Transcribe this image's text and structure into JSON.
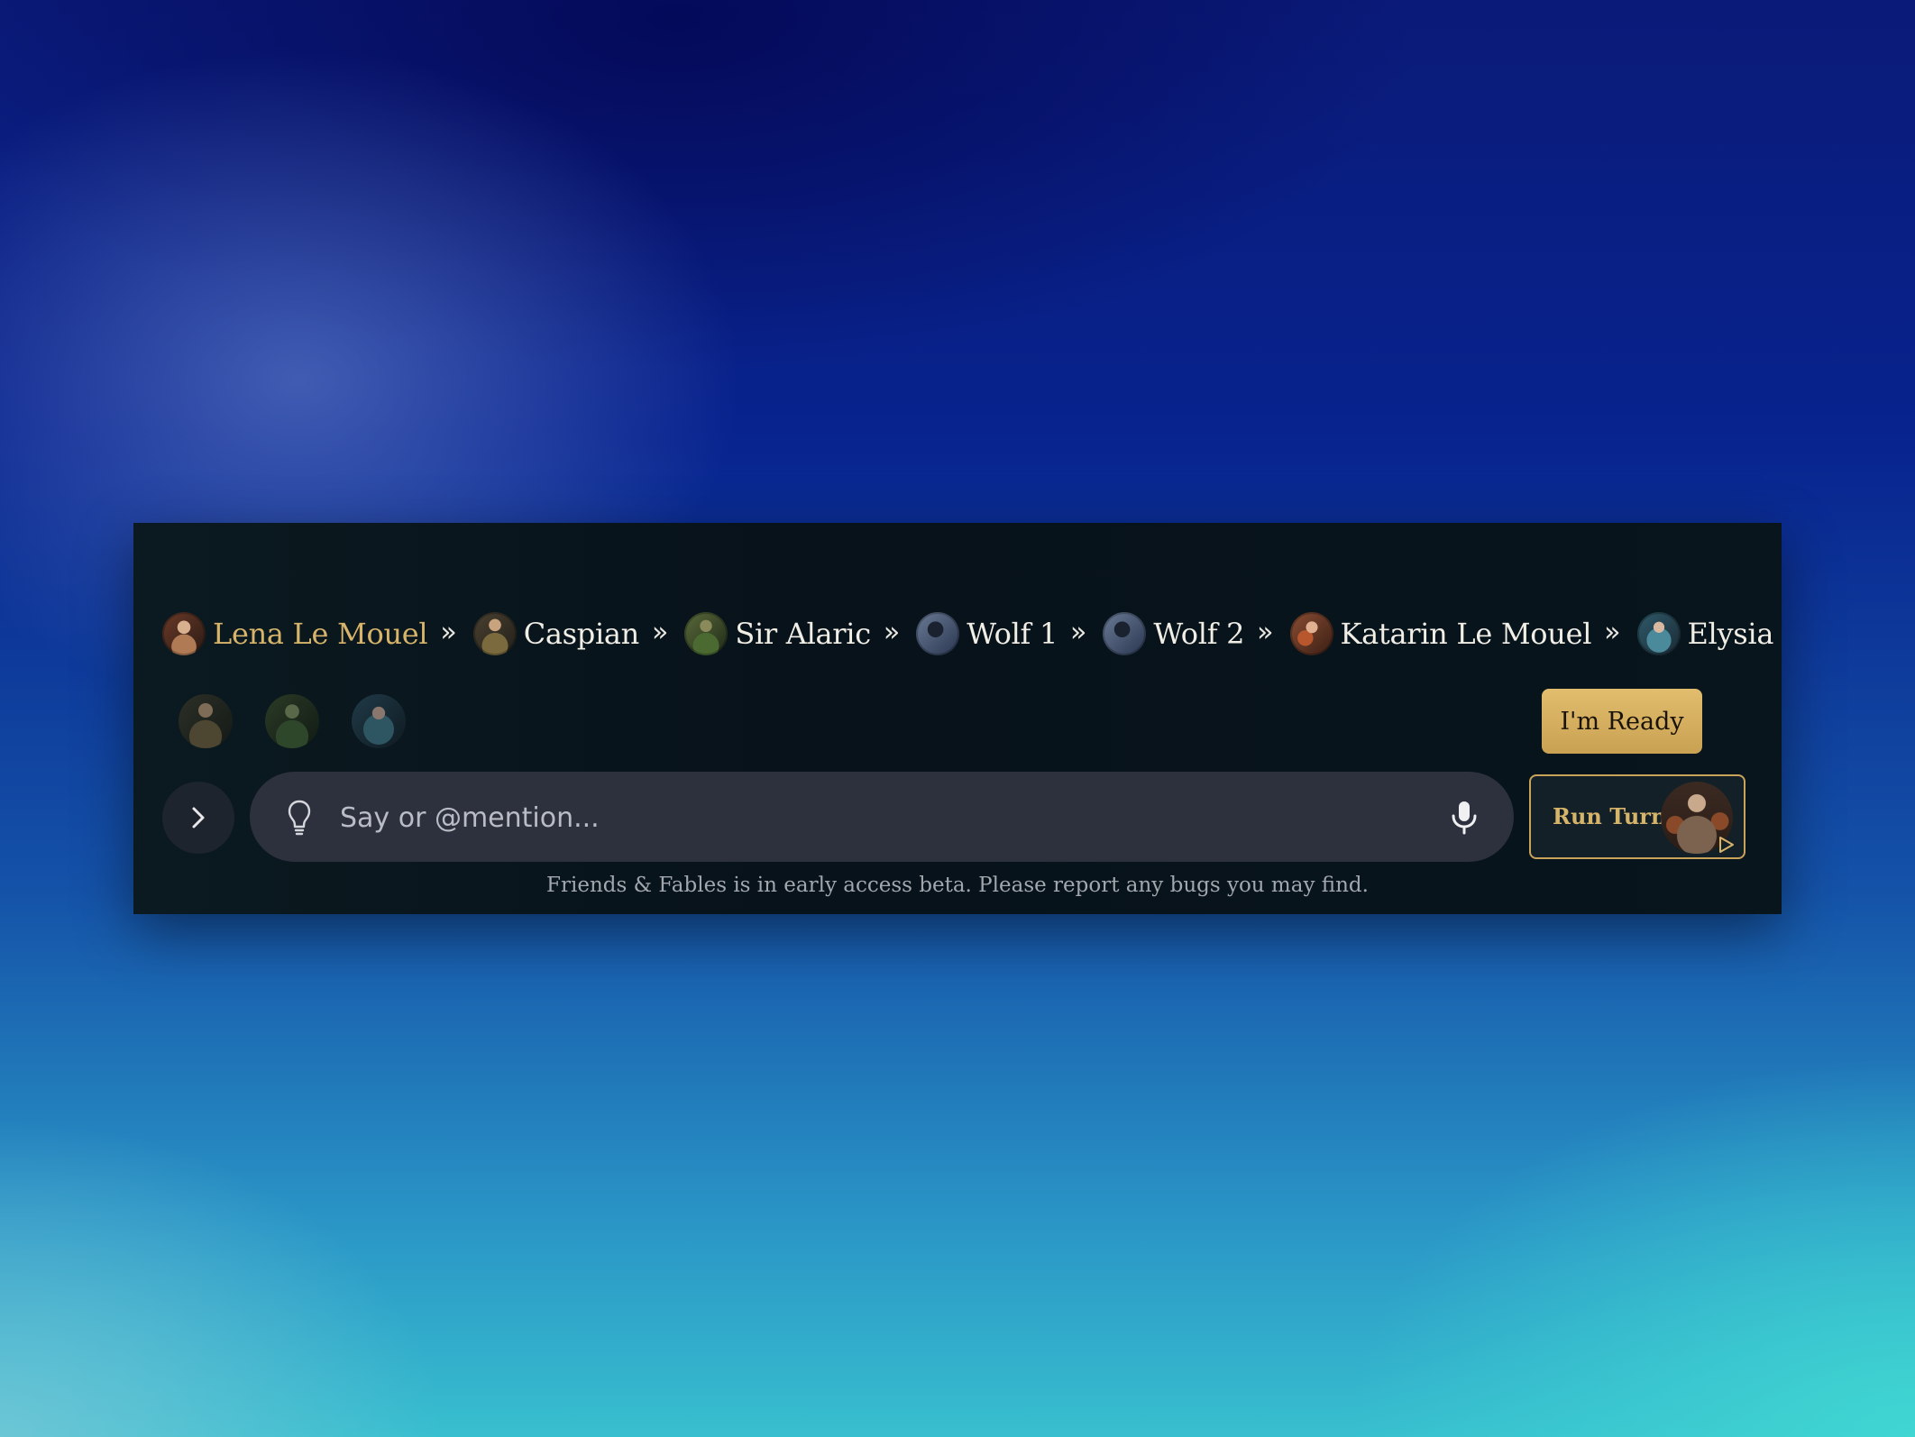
{
  "turn_order": {
    "items": [
      {
        "name": "Lena Le Mouel",
        "active": true,
        "avatar_color": "#8b5a43"
      },
      {
        "name": "Caspian",
        "active": false,
        "avatar_color": "#6b5a3a"
      },
      {
        "name": "Sir Alaric",
        "active": false,
        "avatar_color": "#5b6b3a"
      },
      {
        "name": "Wolf 1",
        "active": false,
        "avatar_color": "#3a4a66"
      },
      {
        "name": "Wolf 2",
        "active": false,
        "avatar_color": "#3a4a66"
      },
      {
        "name": "Katarin Le Mouel",
        "active": false,
        "avatar_color": "#8a4d33"
      },
      {
        "name": "Elysia",
        "active": false,
        "avatar_color": "#3f6b7a"
      }
    ],
    "separator": "»"
  },
  "ready_avatars": [
    {
      "avatar_color": "#4a4a3a"
    },
    {
      "avatar_color": "#3e5a34"
    },
    {
      "avatar_color": "#3d6070"
    }
  ],
  "ready_button": {
    "label": "I'm Ready"
  },
  "composer": {
    "placeholder": "Say or @mention...",
    "value": ""
  },
  "run_turn": {
    "label": "Run Turn"
  },
  "footer": {
    "beta_note": "Friends & Fables is in early access beta. Please report any bugs you may find."
  },
  "colors": {
    "accent_gold": "#d8b46b",
    "panel_bg": "#0a151c",
    "input_bg": "#2d313d"
  }
}
